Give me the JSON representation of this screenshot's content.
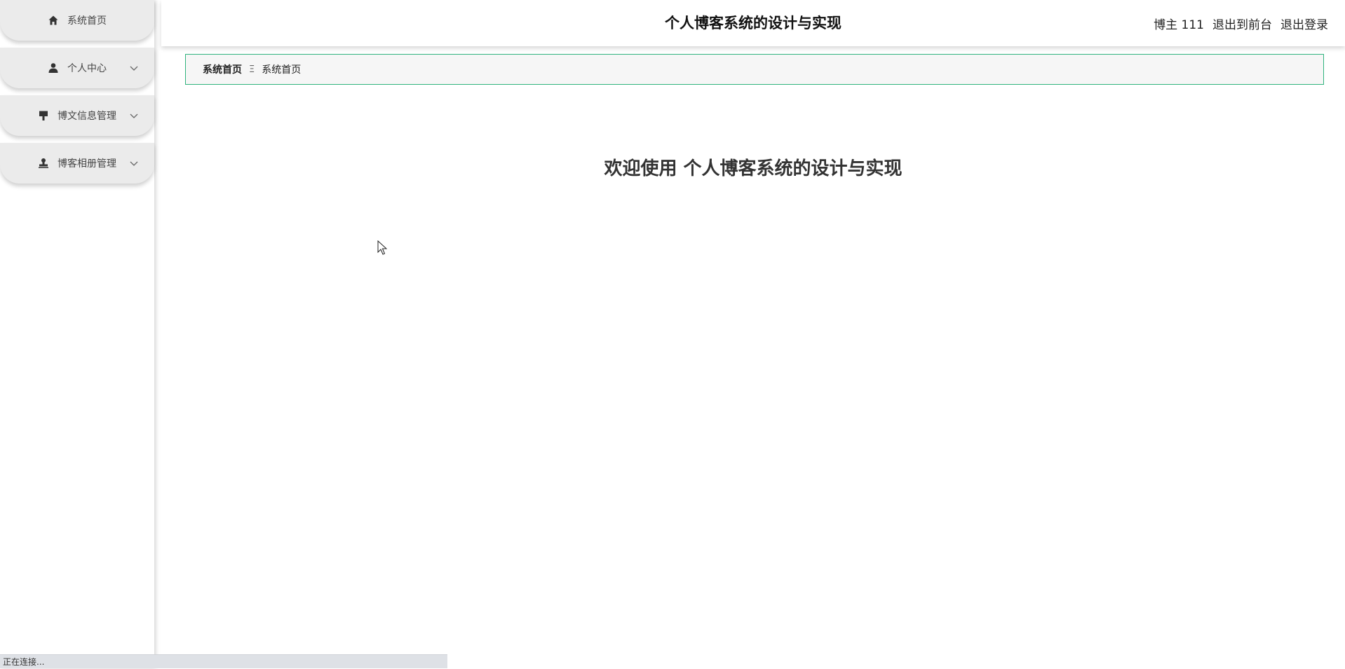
{
  "sidebar": {
    "items": [
      {
        "label": "系统首页",
        "icon": "home-icon",
        "has_submenu": false
      },
      {
        "label": "个人中心",
        "icon": "user-icon",
        "has_submenu": true
      },
      {
        "label": "博文信息管理",
        "icon": "paint-brush-icon",
        "has_submenu": true
      },
      {
        "label": "博客相册管理",
        "icon": "stamp-icon",
        "has_submenu": true
      }
    ]
  },
  "header": {
    "title": "个人博客系统的设计与实现",
    "user": "博主 111",
    "back_to_front": "退出到前台",
    "logout": "退出登录"
  },
  "breadcrumb": {
    "home": "系统首页",
    "separator": "Ξ",
    "current": "系统首页"
  },
  "main": {
    "welcome": "欢迎使用 个人博客系统的设计与实现"
  },
  "status": {
    "text": "正在连接..."
  },
  "colors": {
    "accent": "#2fb37d",
    "menu_bg": "#ebebeb",
    "text": "#333333"
  }
}
